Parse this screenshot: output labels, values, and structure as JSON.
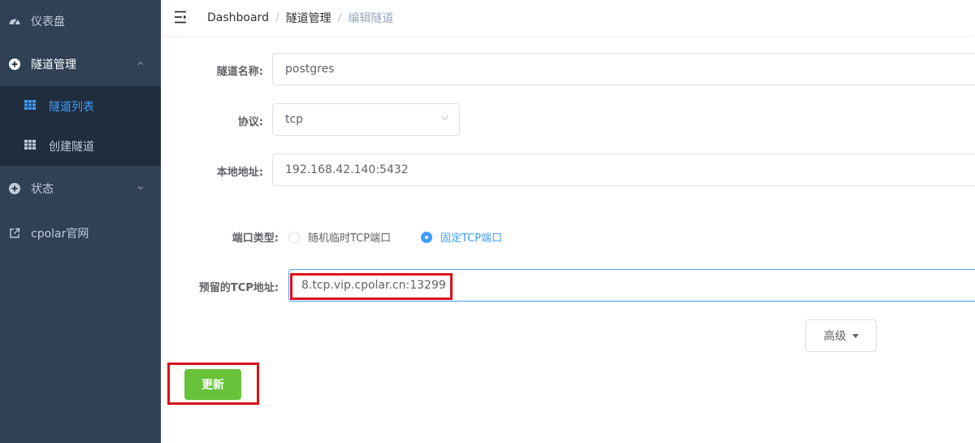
{
  "sidebar": {
    "dashboard": {
      "label": "仪表盘",
      "icon": "dashboard-icon"
    },
    "tunnel_mgmt": {
      "label": "隧道管理",
      "icon": "plus-circle-icon",
      "expanded": true
    },
    "tunnel_list": {
      "label": "隧道列表",
      "icon": "table-icon",
      "active": true
    },
    "create_tunnel": {
      "label": "创建隧道",
      "icon": "table-icon"
    },
    "status": {
      "label": "状态",
      "icon": "plus-circle-icon"
    },
    "website": {
      "label": "cpolar官网",
      "icon": "external-link-icon"
    }
  },
  "header": {
    "breadcrumb": [
      "Dashboard",
      "隧道管理",
      "编辑隧道"
    ]
  },
  "form": {
    "name_label": "隧道名称:",
    "name_value": "postgres",
    "protocol_label": "协议:",
    "protocol_value": "tcp",
    "local_addr_label": "本地地址:",
    "local_addr_value": "192.168.42.140:5432",
    "port_type_label": "端口类型:",
    "port_type_options": [
      "随机临时TCP端口",
      "固定TCP端口"
    ],
    "port_type_selected": 1,
    "reserved_tcp_label": "预留的TCP地址:",
    "reserved_tcp_value": "8.tcp.vip.cpolar.cn:13299",
    "advanced_label": "高级",
    "update_label": "更新"
  },
  "colors": {
    "sidebar_bg": "#304156",
    "submenu_bg": "#1f2d3d",
    "active": "#409eff",
    "success": "#67c23a",
    "highlight": "#d8121c"
  }
}
